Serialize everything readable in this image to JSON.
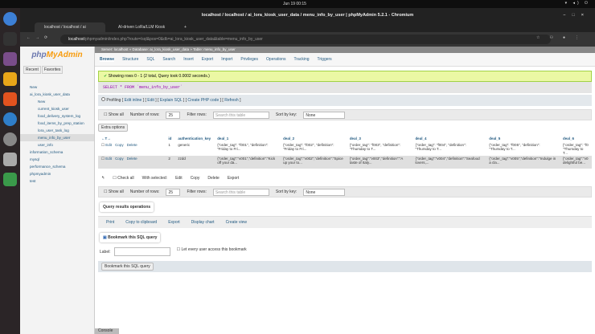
{
  "system": {
    "clock": "Jun 19  00:15",
    "tray": "▾ ◂) ⏻"
  },
  "browser": {
    "title": "localhost / localhost / ai_lora_kiosk_user_data / menu_info_by_user | phpMyAdmin 5.2.1 - Chromium",
    "tabs": [
      {
        "label": "localhost / localhost / ai"
      },
      {
        "label": "AI-driven LoRa/LLM Kiosk"
      }
    ],
    "url_host": "localhost",
    "url_path": "/phpmyadmin/index.php?route=/sql&pos=0&db=ai_lora_kiosk_user_data&table=menu_info_by_user"
  },
  "sidebar": {
    "logo_php": "php",
    "logo_my": "MyAdmin",
    "tabs": [
      "Recent",
      "Favorites"
    ],
    "tree": [
      {
        "label": "New",
        "level": 0
      },
      {
        "label": "ai_lora_kiosk_user_data",
        "level": 0
      },
      {
        "label": "New",
        "level": 1
      },
      {
        "label": "current_kiosk_user",
        "level": 1
      },
      {
        "label": "food_delivery_system_log",
        "level": 1
      },
      {
        "label": "food_items_by_prep_station",
        "level": 1
      },
      {
        "label": "lora_user_task_log",
        "level": 1
      },
      {
        "label": "menu_info_by_user",
        "level": 1
      },
      {
        "label": "user_info",
        "level": 1
      },
      {
        "label": "information_schema",
        "level": 0
      },
      {
        "label": "mysql",
        "level": 0
      },
      {
        "label": "performance_schema",
        "level": 0
      },
      {
        "label": "phpmyadmin",
        "level": 0
      },
      {
        "label": "test",
        "level": 0
      }
    ]
  },
  "breadcrumb": [
    "Server: localhost",
    "Database: ai_lora_kiosk_user_data",
    "Table: menu_info_by_user"
  ],
  "menu": [
    "Browse",
    "Structure",
    "SQL",
    "Search",
    "Insert",
    "Export",
    "Import",
    "Privileges",
    "Operations",
    "Tracking",
    "Triggers"
  ],
  "message": "Showing rows 0 - 1 (2 total, Query took 0.0002 seconds.)",
  "sql": "SELECT * FROM `menu_info_by_user`",
  "profiling": {
    "label": "Profiling",
    "links": [
      "Edit inline",
      "Edit",
      "Explain SQL",
      "Create PHP code",
      "Refresh"
    ]
  },
  "nav": {
    "show_all": "Show all",
    "rows_label": "Number of rows:",
    "rows": "25",
    "filter_label": "Filter rows:",
    "filter_placeholder": "Search this table",
    "sort_label": "Sort by key:",
    "sort": "None"
  },
  "extra_options": "Extra options",
  "table": {
    "headers": [
      "id",
      "authentication_key",
      "deal_1",
      "deal_2",
      "deal_3",
      "deal_4",
      "deal_5",
      "deal_6"
    ],
    "actions": [
      "Edit",
      "Copy",
      "Delete"
    ],
    "rows": [
      [
        "1",
        "generic",
        "{\"order_tag\": \"f001\", \"definition\": \"Friday to Fri...",
        "{\"order_tag\": \"f002\", \"definition\": \"Friday to Fri...",
        "{\"order_tag\": \"f003\", \"definition\": \"Thursday to T...",
        "{\"order_tag\": \"f004\", \"definition\": \"Thursday to T...",
        "{\"order_tag\": \"f005\", \"definition\": \"Thursday to T...",
        "{\"order_tag\": \"f0 \"Thursday to T..."
      ],
      [
        "2",
        "zzdd",
        "{\"order_tag\":\"v001\",\"definition\":\"Kick off your da...",
        "{\"order_tag\":\"v002\",\"definition\":\"Spice up your to...",
        "{\"order_tag\":\"v003\",\"definition\":\"A taste of Italy...",
        "{\"order_tag\":\"v004\",\"definition\":\"Seafood lovers,...",
        "{\"order_tag\":\"v005\",\"definition\":\"Indulge in a cla...",
        "{\"order_tag\":\"v0 delightful be..."
      ]
    ]
  },
  "bulk": {
    "check_all": "Check all",
    "with_selected": "With selected:",
    "edit": "Edit",
    "copy": "Copy",
    "delete": "Delete",
    "export": "Export"
  },
  "ops": {
    "title": "Query results operations",
    "items": [
      "Print",
      "Copy to clipboard",
      "Export",
      "Display chart",
      "Create view"
    ]
  },
  "bookmark": {
    "title": "Bookmark this SQL query",
    "label": "Label:",
    "share": "Let every user access this bookmark",
    "button": "Bookmark this SQL query"
  },
  "console": "Console"
}
